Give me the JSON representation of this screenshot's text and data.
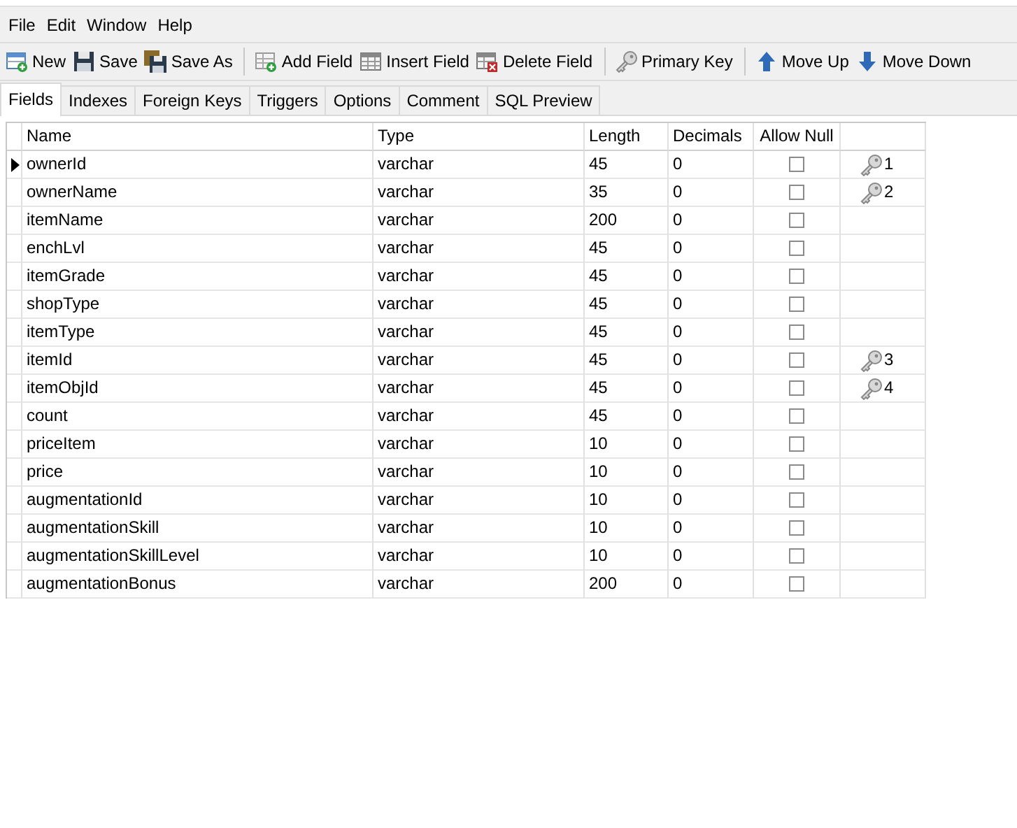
{
  "menu": [
    "File",
    "Edit",
    "Window",
    "Help"
  ],
  "toolbar": [
    [
      {
        "label": "New"
      },
      {
        "label": "Save"
      },
      {
        "label": "Save As"
      }
    ],
    [
      {
        "label": "Add Field"
      },
      {
        "label": "Insert Field"
      },
      {
        "label": "Delete Field"
      }
    ],
    [
      {
        "label": "Primary Key"
      }
    ],
    [
      {
        "label": "Move Up"
      },
      {
        "label": "Move Down"
      }
    ]
  ],
  "tabs": [
    {
      "label": "Fields",
      "selected": true
    },
    {
      "label": "Indexes",
      "selected": false
    },
    {
      "label": "Foreign Keys",
      "selected": false
    },
    {
      "label": "Triggers",
      "selected": false
    },
    {
      "label": "Options",
      "selected": false
    },
    {
      "label": "Comment",
      "selected": false
    },
    {
      "label": "SQL Preview",
      "selected": false
    }
  ],
  "table": {
    "columns": [
      "Name",
      "Type",
      "Length",
      "Decimals",
      "Allow Null"
    ],
    "rows": [
      {
        "name": "ownerId",
        "type": "varchar",
        "length": "45",
        "decimals": "0",
        "allow_null": false,
        "current": true,
        "key": "1"
      },
      {
        "name": "ownerName",
        "type": "varchar",
        "length": "35",
        "decimals": "0",
        "allow_null": false,
        "current": false,
        "key": "2"
      },
      {
        "name": "itemName",
        "type": "varchar",
        "length": "200",
        "decimals": "0",
        "allow_null": false,
        "current": false
      },
      {
        "name": "enchLvl",
        "type": "varchar",
        "length": "45",
        "decimals": "0",
        "allow_null": false,
        "current": false
      },
      {
        "name": "itemGrade",
        "type": "varchar",
        "length": "45",
        "decimals": "0",
        "allow_null": false,
        "current": false
      },
      {
        "name": "shopType",
        "type": "varchar",
        "length": "45",
        "decimals": "0",
        "allow_null": false,
        "current": false
      },
      {
        "name": "itemType",
        "type": "varchar",
        "length": "45",
        "decimals": "0",
        "allow_null": false,
        "current": false
      },
      {
        "name": "itemId",
        "type": "varchar",
        "length": "45",
        "decimals": "0",
        "allow_null": false,
        "current": false,
        "key": "3"
      },
      {
        "name": "itemObjId",
        "type": "varchar",
        "length": "45",
        "decimals": "0",
        "allow_null": false,
        "current": false,
        "key": "4"
      },
      {
        "name": "count",
        "type": "varchar",
        "length": "45",
        "decimals": "0",
        "allow_null": false,
        "current": false
      },
      {
        "name": "priceItem",
        "type": "varchar",
        "length": "10",
        "decimals": "0",
        "allow_null": false,
        "current": false
      },
      {
        "name": "price",
        "type": "varchar",
        "length": "10",
        "decimals": "0",
        "allow_null": false,
        "current": false
      },
      {
        "name": "augmentationId",
        "type": "varchar",
        "length": "10",
        "decimals": "0",
        "allow_null": false,
        "current": false
      },
      {
        "name": "augmentationSkill",
        "type": "varchar",
        "length": "10",
        "decimals": "0",
        "allow_null": false,
        "current": false
      },
      {
        "name": "augmentationSkillLevel",
        "type": "varchar",
        "length": "10",
        "decimals": "0",
        "allow_null": false,
        "current": false
      },
      {
        "name": "augmentationBonus",
        "type": "varchar",
        "length": "200",
        "decimals": "0",
        "allow_null": false,
        "current": false
      }
    ]
  }
}
